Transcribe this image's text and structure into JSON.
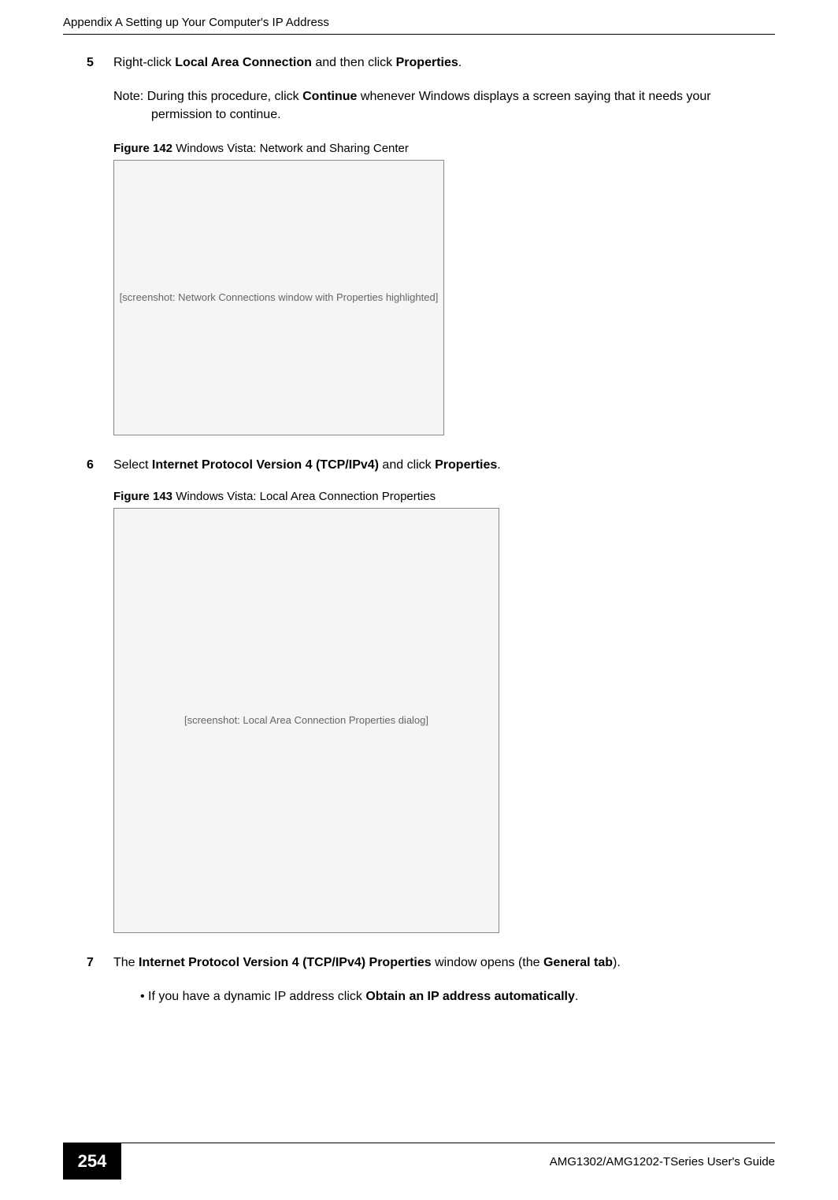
{
  "header": {
    "running_head": "Appendix A Setting up Your Computer's IP Address"
  },
  "step5": {
    "num": "5",
    "pre": "Right-click ",
    "bold1": "Local Area Connection",
    "mid": " and then click ",
    "bold2": "Properties",
    "post": "."
  },
  "note": {
    "pre": "Note: During this procedure, click ",
    "bold": "Continue",
    "post": " whenever Windows displays a screen saying that it needs your permission to continue."
  },
  "fig142": {
    "label": "Figure 142",
    "caption": "   Windows Vista: Network and Sharing Center",
    "placeholder": "[screenshot: Network Connections window with Properties highlighted]"
  },
  "step6": {
    "num": "6",
    "pre": "Select ",
    "bold1": "Internet Protocol Version 4 (TCP/IPv4)",
    "mid": " and click ",
    "bold2": "Properties",
    "post": "."
  },
  "fig143": {
    "label": "Figure 143",
    "caption": "   Windows Vista: Local Area Connection Properties",
    "placeholder": "[screenshot: Local Area Connection Properties dialog]"
  },
  "step7": {
    "num": "7",
    "pre": "The ",
    "bold1": "Internet Protocol Version 4 (TCP/IPv4) Properties",
    "mid": " window opens (the ",
    "bold2": "General tab",
    "post": ")."
  },
  "bullet1": {
    "marker": "• ",
    "pre": "If you have a dynamic IP address click ",
    "bold": "Obtain an IP address automatically",
    "post": "."
  },
  "footer": {
    "page": "254",
    "guide": "AMG1302/AMG1202-TSeries User's Guide"
  }
}
